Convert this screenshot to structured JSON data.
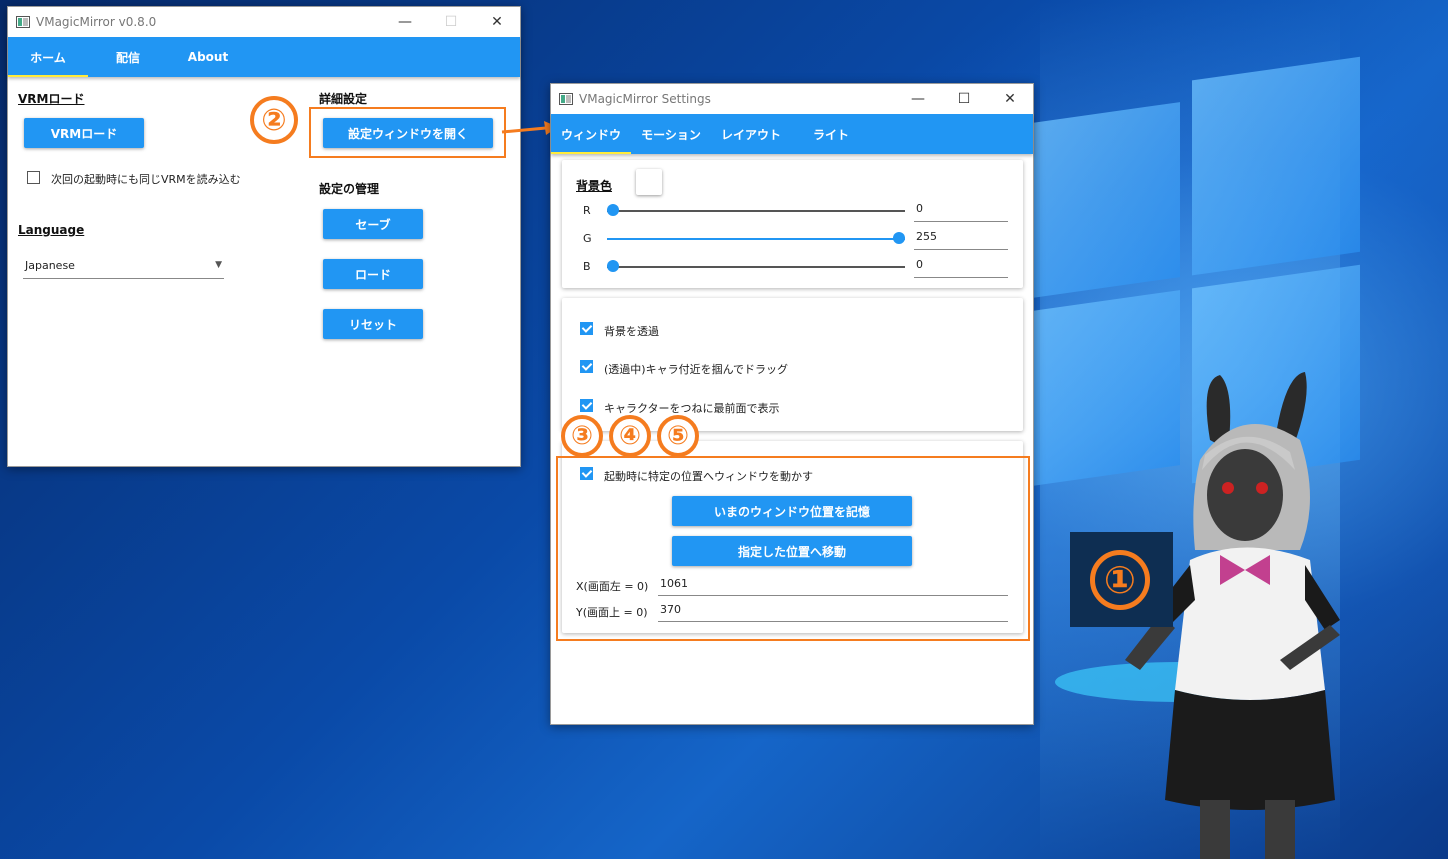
{
  "main_window": {
    "title": "VMagicMirror v0.8.0",
    "tabs": [
      {
        "label": "ホーム",
        "active": true
      },
      {
        "label": "配信",
        "active": false
      },
      {
        "label": "About",
        "active": false
      }
    ],
    "vrm_section": "VRMロード",
    "vrm_load_button": "VRMロード",
    "autoload_checkbox": "次回の起動時にも同じVRMを読み込む",
    "language_section": "Language",
    "language_value": "Japanese",
    "advanced_section": "詳細設定",
    "open_settings_button": "設定ウィンドウを開く",
    "manage_section": "設定の管理",
    "save_button": "セーブ",
    "load_button": "ロード",
    "reset_button": "リセット"
  },
  "settings_window": {
    "title": "VMagicMirror Settings",
    "tabs": [
      {
        "label": "ウィンドウ",
        "active": true
      },
      {
        "label": "モーション",
        "active": false
      },
      {
        "label": "レイアウト",
        "active": false
      },
      {
        "label": "ライト",
        "active": false
      }
    ],
    "bg_color_label": "背景色",
    "bg_color_value": "#ffffff",
    "sliders": [
      {
        "label": "R",
        "value": "0",
        "fraction": 0.0
      },
      {
        "label": "G",
        "value": "255",
        "fraction": 1.0
      },
      {
        "label": "B",
        "value": "0",
        "fraction": 0.0
      }
    ],
    "checkboxes": [
      {
        "label": "背景を透過",
        "checked": true
      },
      {
        "label": "(透過中)キャラ付近を掴んでドラッグ",
        "checked": true
      },
      {
        "label": "キャラクターをつねに最前面で表示",
        "checked": true
      }
    ],
    "startup_checkbox": "起動時に特定の位置へウィンドウを動かす",
    "remember_pos_button": "いまのウィンドウ位置を記憶",
    "move_pos_button": "指定した位置へ移動",
    "x_label": "X(画面左 = 0)",
    "x_value": "1061",
    "y_label": "Y(画面上 = 0)",
    "y_value": "370"
  },
  "annotations": {
    "n1": "①",
    "n2": "②",
    "n3": "③",
    "n4": "④",
    "n5": "⑤",
    "accent_color": "#f57c1f"
  },
  "colors": {
    "tab_blue": "#2196f3",
    "active_tab_underline": "#ffeb3b"
  }
}
